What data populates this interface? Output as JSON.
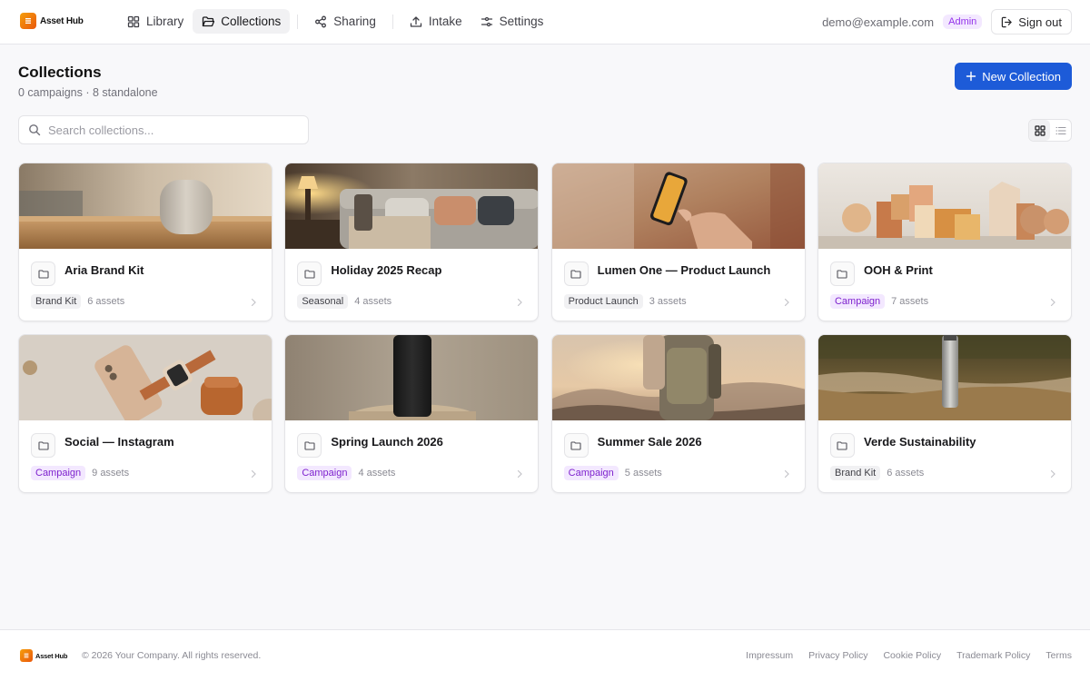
{
  "header": {
    "logo_text": "Asset Hub",
    "nav": [
      {
        "label": "Library",
        "icon": "grid-icon"
      },
      {
        "label": "Collections",
        "icon": "folder-open-icon",
        "active": true
      },
      {
        "label": "Sharing",
        "icon": "share-icon"
      },
      {
        "label": "Intake",
        "icon": "upload-icon"
      },
      {
        "label": "Settings",
        "icon": "sliders-icon"
      }
    ],
    "user_email": "demo@example.com",
    "role_badge": "Admin",
    "signout_label": "Sign out"
  },
  "page": {
    "title": "Collections",
    "subtitle": "0 campaigns · 8 standalone",
    "new_button_label": "New Collection",
    "search_placeholder": "Search collections...",
    "view_mode": "grid"
  },
  "colors": {
    "primary": "#1d5bd8",
    "campaign_tag_bg": "#f3e8ff",
    "campaign_tag_text": "#7e22ce",
    "admin_badge": "#9333ea"
  },
  "collections": [
    {
      "title": "Aria Brand Kit",
      "tag": "Brand Kit",
      "tag_style": "neutral",
      "count": "6 assets",
      "thumb": "smart-speaker-on-wood-table"
    },
    {
      "title": "Holiday 2025 Recap",
      "tag": "Seasonal",
      "tag_style": "neutral",
      "count": "4 assets",
      "thumb": "living-room-sofa-lamp"
    },
    {
      "title": "Lumen One — Product Launch",
      "tag": "Product Launch",
      "tag_style": "neutral",
      "count": "3 assets",
      "thumb": "hand-holding-phone"
    },
    {
      "title": "OOH & Print",
      "tag": "Campaign",
      "tag_style": "campaign",
      "count": "7 assets",
      "thumb": "wooden-blocks"
    },
    {
      "title": "Social — Instagram",
      "tag": "Campaign",
      "tag_style": "campaign",
      "count": "9 assets",
      "thumb": "phone-watch-earbuds-flatlay"
    },
    {
      "title": "Spring Launch 2026",
      "tag": "Campaign",
      "tag_style": "campaign",
      "count": "4 assets",
      "thumb": "phone-on-pedestal"
    },
    {
      "title": "Summer Sale 2026",
      "tag": "Campaign",
      "tag_style": "campaign",
      "count": "5 assets",
      "thumb": "hiker-mountain-sunrise"
    },
    {
      "title": "Verde Sustainability",
      "tag": "Brand Kit",
      "tag_style": "neutral",
      "count": "6 assets",
      "thumb": "bottle-by-stream"
    }
  ],
  "footer": {
    "logo_text": "Asset Hub",
    "copyright": "© 2026 Your Company. All rights reserved.",
    "links": [
      "Impressum",
      "Privacy Policy",
      "Cookie Policy",
      "Trademark Policy",
      "Terms"
    ]
  }
}
